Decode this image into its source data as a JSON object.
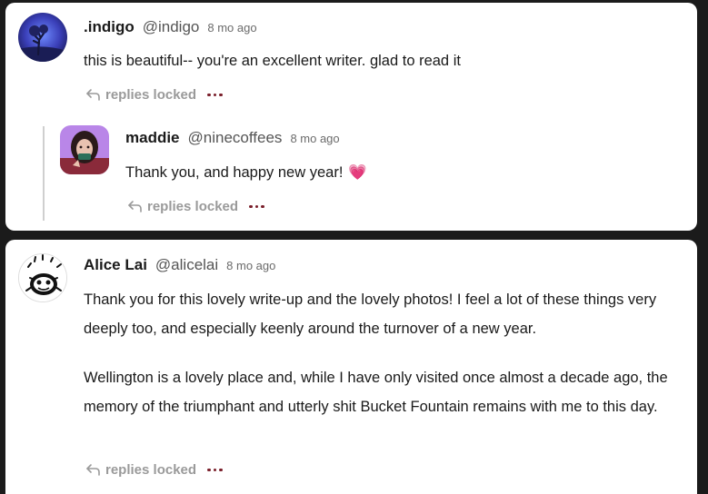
{
  "comments": [
    {
      "name": ".indigo",
      "handle": "@indigo",
      "time": "8 mo ago",
      "text": "this is beautiful-- you're an excellent writer. glad to read it",
      "replies_label": "replies locked"
    },
    {
      "name": "maddie",
      "handle": "@ninecoffees",
      "time": "8 mo ago",
      "text": "Thank you, and happy new year!",
      "emoji": "💗",
      "replies_label": "replies locked"
    },
    {
      "name": "Alice Lai",
      "handle": "@alicelai",
      "time": "8 mo ago",
      "paragraph1": "Thank you for this lovely write-up and the lovely photos! I feel a lot of these things very deeply too, and especially keenly around the turnover of a new year.",
      "paragraph2": "Wellington is a lovely place and, while I have only visited once almost a decade ago, the memory of the triumphant and utterly shit Bucket Fountain remains with me to this day.",
      "replies_label": "replies locked"
    }
  ],
  "colors": {
    "background": "#1b1b1b",
    "card": "#ffffff",
    "dots": "#7a1f2b",
    "muted": "#9a9a9a"
  }
}
